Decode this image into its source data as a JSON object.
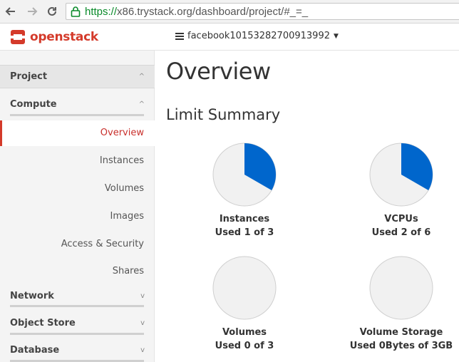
{
  "browser": {
    "url_scheme": "https://",
    "url_rest": "x86.trystack.org/dashboard/project/#_=_"
  },
  "header": {
    "brand": "openstack",
    "project_name": "facebook10153282700913992"
  },
  "sidebar": {
    "project_label": "Project",
    "compute_label": "Compute",
    "items": [
      {
        "label": "Overview",
        "active": true
      },
      {
        "label": "Instances"
      },
      {
        "label": "Volumes"
      },
      {
        "label": "Images"
      },
      {
        "label": "Access & Security"
      },
      {
        "label": "Shares"
      }
    ],
    "network_label": "Network",
    "object_store_label": "Object Store",
    "database_label": "Database"
  },
  "main": {
    "title": "Overview",
    "section_title": "Limit Summary"
  },
  "colors": {
    "used": "#0066cc",
    "free": "#f1f1f1",
    "accent": "#d43a2a"
  },
  "chart_data": [
    {
      "type": "pie",
      "title": "Instances",
      "label": "Used 1 of 3",
      "used": 1,
      "total": 3
    },
    {
      "type": "pie",
      "title": "VCPUs",
      "label": "Used 2 of 6",
      "used": 2,
      "total": 6
    },
    {
      "type": "pie",
      "title": "Volumes",
      "label": "Used 0 of 3",
      "used": 0,
      "total": 3
    },
    {
      "type": "pie",
      "title": "Volume Storage",
      "label": "Used 0Bytes of 3GB",
      "used": 0,
      "total": 3
    }
  ]
}
